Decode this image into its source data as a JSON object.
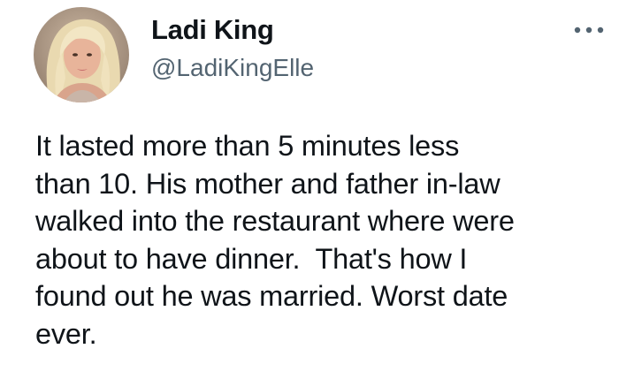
{
  "tweet": {
    "author": {
      "display_name": "Ladi King",
      "handle": "@LadiKingElle",
      "avatar_icon": "profile-photo"
    },
    "more_icon": "more-horizontal-icon",
    "text": "It lasted more than 5 minutes less\nthan 10. His mother and father in-law\nwalked into the restaurant where were\nabout to have dinner.  That's how I\nfound out he was married. Worst date\never."
  },
  "colors": {
    "text": "#0f1419",
    "handle": "#536471",
    "background": "#ffffff"
  }
}
